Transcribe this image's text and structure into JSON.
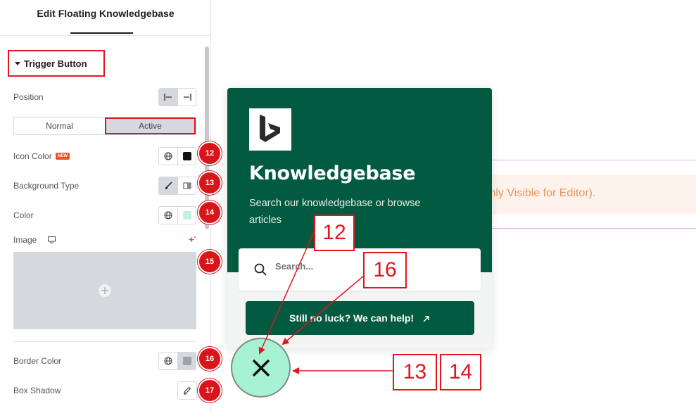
{
  "panel": {
    "title": "Edit Floating Knowledgebase",
    "section_label": "Trigger Button",
    "controls": {
      "position_label": "Position",
      "normal_tab": "Normal",
      "active_tab": "Active",
      "icon_color_label": "Icon Color",
      "new_badge": "NEW",
      "background_type_label": "Background Type",
      "color_label": "Color",
      "image_label": "Image",
      "border_color_label": "Border Color",
      "box_shadow_label": "Box Shadow"
    },
    "swatches": {
      "icon_color": "#111111",
      "color": "#bff3dd",
      "border_color": "#9ea3a8"
    },
    "markers": [
      "12",
      "13",
      "14",
      "15",
      "16",
      "17"
    ]
  },
  "preview": {
    "notice_text": "Only Visible for Editor).",
    "kb": {
      "title": "Knowledgebase",
      "subtitle": "Search our knowledgebase or browse articles",
      "search_placeholder": "Search...",
      "help_button": "Still no luck? We can help!"
    },
    "annotations": {
      "label_12": "12",
      "label_16": "16",
      "label_13": "13",
      "label_14": "14"
    }
  },
  "colors": {
    "brand_green": "#025a40",
    "trigger_bg": "#a7f2d3",
    "annotation_red": "#e0161f"
  },
  "icons": [
    "caret-down-icon",
    "align-left-icon",
    "align-right-icon",
    "globe-icon",
    "brush-icon",
    "gradient-icon",
    "desktop-icon",
    "sparkle-icon",
    "plus-icon",
    "pencil-icon",
    "bing-logo",
    "search-icon",
    "arrow-up-right-icon",
    "close-icon"
  ]
}
